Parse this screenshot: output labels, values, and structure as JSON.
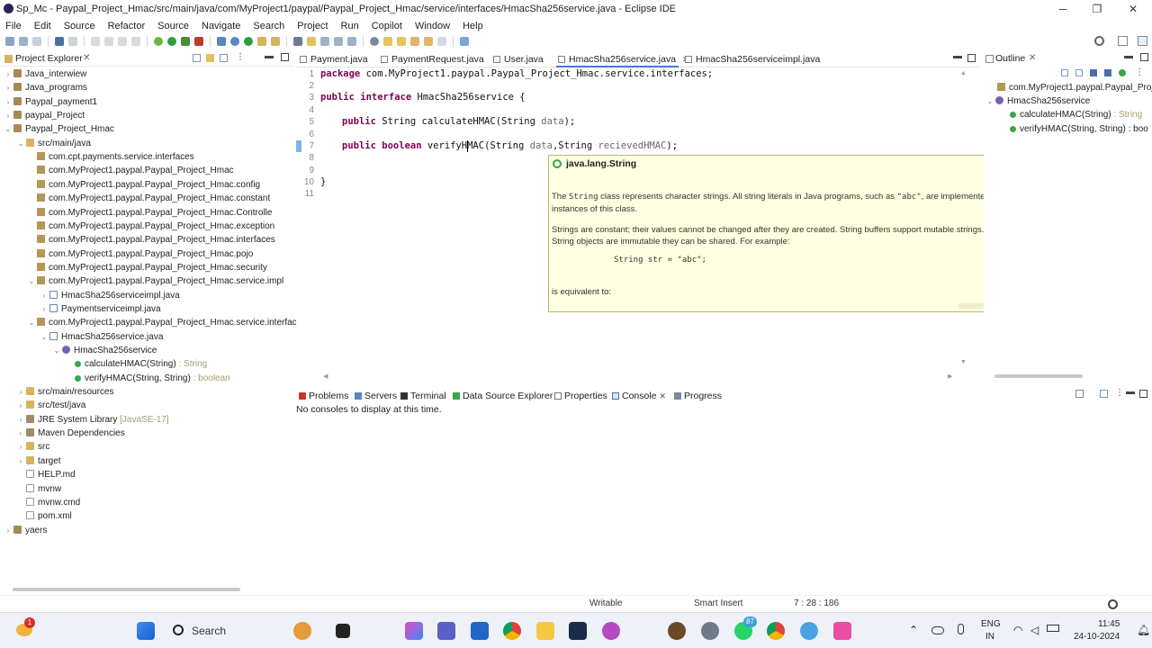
{
  "window": {
    "title": "Sp_Mc - Paypal_Project_Hmac/src/main/java/com/MyProject1/paypal/Paypal_Project_Hmac/service/interfaces/HmacSha256service.java - Eclipse IDE",
    "minimize": "─",
    "maximize": "❐",
    "close": "✕"
  },
  "menu": [
    "File",
    "Edit",
    "Source",
    "Refactor",
    "Source",
    "Navigate",
    "Search",
    "Project",
    "Run",
    "Copilot",
    "Window",
    "Help"
  ],
  "project_explorer": {
    "title": "Project Explorer",
    "items": [
      {
        "label": "Java_interwiew",
        "icon": "project-icon"
      },
      {
        "label": "Java_programs",
        "icon": "project-icon"
      },
      {
        "label": "Paypal_payment1",
        "icon": "project-icon"
      },
      {
        "label": "paypal_Project",
        "icon": "project-icon"
      },
      {
        "label": "Paypal_Project_Hmac",
        "icon": "project-icon"
      },
      {
        "label": "src/main/java",
        "icon": "source-folder-icon"
      },
      {
        "label": "com.cpt.payments.service.interfaces",
        "icon": "package-icon"
      },
      {
        "label": "com.MyProject1.paypal.Paypal_Project_Hmac",
        "icon": "package-icon"
      },
      {
        "label": "com.MyProject1.paypal.Paypal_Project_Hmac.config",
        "icon": "package-icon"
      },
      {
        "label": "com.MyProject1.paypal.Paypal_Project_Hmac.constant",
        "icon": "package-icon"
      },
      {
        "label": "com.MyProject1.paypal.Paypal_Project_Hmac.Controlle",
        "icon": "package-icon"
      },
      {
        "label": "com.MyProject1.paypal.Paypal_Project_Hmac.exception",
        "icon": "package-icon"
      },
      {
        "label": "com.MyProject1.paypal.Paypal_Project_Hmac.interfaces",
        "icon": "package-icon"
      },
      {
        "label": "com.MyProject1.paypal.Paypal_Project_Hmac.pojo",
        "icon": "package-icon"
      },
      {
        "label": "com.MyProject1.paypal.Paypal_Project_Hmac.security",
        "icon": "package-icon"
      },
      {
        "label": "com.MyProject1.paypal.Paypal_Project_Hmac.service.impl",
        "icon": "package-icon"
      },
      {
        "label": "HmacSha256serviceimpl.java",
        "icon": "java-file-icon"
      },
      {
        "label": "Paymentserviceimpl.java",
        "icon": "java-file-icon"
      },
      {
        "label": "com.MyProject1.paypal.Paypal_Project_Hmac.service.interface",
        "icon": "package-icon"
      },
      {
        "label": "HmacSha256service.java",
        "icon": "java-file-icon"
      },
      {
        "label": "HmacSha256service",
        "icon": "interface-icon"
      },
      {
        "label": "calculateHMAC(String)",
        "suffix": " : String",
        "icon": "method-icon"
      },
      {
        "label": "verifyHMAC(String, String)",
        "suffix": " : boolean",
        "icon": "method-icon"
      },
      {
        "label": "src/main/resources",
        "icon": "source-folder-icon"
      },
      {
        "label": "src/test/java",
        "icon": "source-folder-icon"
      },
      {
        "label": "JRE System Library",
        "suffix": " [JavaSE-17]",
        "icon": "library-icon"
      },
      {
        "label": "Maven Dependencies",
        "icon": "library-icon"
      },
      {
        "label": "src",
        "icon": "folder-icon"
      },
      {
        "label": "target",
        "icon": "folder-icon"
      },
      {
        "label": "HELP.md",
        "icon": "file-icon"
      },
      {
        "label": "mvnw",
        "icon": "file-icon"
      },
      {
        "label": "mvnw.cmd",
        "icon": "file-icon"
      },
      {
        "label": "pom.xml",
        "icon": "file-icon"
      },
      {
        "label": "yaers",
        "icon": "project-icon"
      }
    ]
  },
  "editor": {
    "tabs": [
      "Payment.java",
      "PaymentRequest.java",
      "User.java",
      "HmacSha256service.java",
      "HmacSha256serviceimpl.java"
    ],
    "active_tab": "HmacSha256service.java",
    "tab_close": "✕",
    "line_numbers": [
      "1",
      "2",
      "3",
      "4",
      "5",
      "6",
      "7",
      "8",
      "9",
      "10",
      "11"
    ],
    "code": {
      "l1_kw": "package",
      "l1_rest": " com.MyProject1.paypal.Paypal_Project_Hmac.service.interfaces;",
      "l3_kw1": "public",
      "l3_kw2": "interface",
      "l3_rest": " HmacSha256service {",
      "l5_kw": "public",
      "l5_a": " String calculateHMAC(String ",
      "l5_p": "data",
      "l5_b": ");",
      "l7_kw1": "public",
      "l7_kw2": "boolean",
      "l7_a": " verifyHMAC(String ",
      "l7_p1": "data",
      "l7_b": ",String ",
      "l7_p2": "recievedHMAC",
      "l7_c": ");",
      "l10": "}"
    }
  },
  "tooltip": {
    "header": "java.lang.String",
    "p1_a": "The ",
    "p1_code": "String",
    "p1_b": " class represents character strings. All string literals in Java programs, such as ",
    "p1_code2": "\"abc\"",
    "p1_c": ", are implemented as instances of this class.",
    "p2": "Strings are constant; their values cannot be changed after they are created. String buffers support mutable strings. Because String objects are immutable they can be shared. For example:",
    "example": "String str = \"abc\";",
    "p3": "is equivalent to:"
  },
  "outline": {
    "title": "Outline",
    "items": [
      {
        "label": "com.MyProject1.paypal.Paypal_Proj"
      },
      {
        "label": "HmacSha256service"
      },
      {
        "label": "calculateHMAC(String)",
        "suffix": " : String"
      },
      {
        "label": "verifyHMAC(String, String) : boo"
      }
    ]
  },
  "bottom_panel": {
    "tabs": [
      "Problems",
      "Servers",
      "Terminal",
      "Data Source Explorer",
      "Properties",
      "Console",
      "Progress"
    ],
    "message": "No consoles to display at this time."
  },
  "status": {
    "writable": "Writable",
    "insert": "Smart Insert",
    "position": "7 : 28 : 186"
  },
  "taskbar": {
    "search_label": "Search",
    "notification_count": "1",
    "badge_count": "87",
    "lang_top": "ENG",
    "lang_bottom": "IN",
    "time": "11:45",
    "date": "24-10-2024"
  }
}
